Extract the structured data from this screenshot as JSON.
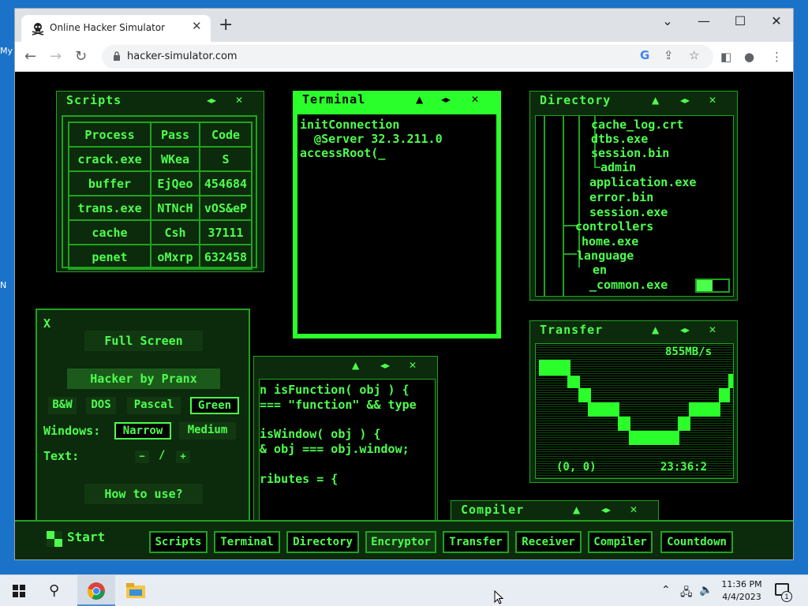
{
  "desktop": {
    "peek_label_1": "My",
    "peek_label_2": "N"
  },
  "browser": {
    "tab_title": "Online Hacker Simulator",
    "url": "hacker-simulator.com"
  },
  "panels": {
    "scripts": {
      "title": "Scripts",
      "headers": [
        "Process",
        "Pass",
        "Code"
      ],
      "rows": [
        [
          "crack.exe",
          "WKea",
          "S"
        ],
        [
          "buffer",
          "EjQeo",
          "454684"
        ],
        [
          "trans.exe",
          "NTNcH",
          "vOS&eP"
        ],
        [
          "cache",
          "Csh",
          "37111"
        ],
        [
          "penet",
          "oMxrp",
          "632458"
        ]
      ]
    },
    "terminal": {
      "title": "Terminal",
      "lines": [
        "initConnection",
        "  @Server 32.3.211.0",
        "accessRoot(_"
      ]
    },
    "directory": {
      "title": "Directory",
      "lines": [
        "cache_log.crt",
        "dtbs.exe",
        "session.bin",
        "admin",
        "application.exe",
        "error.bin",
        "session.exe",
        "controllers",
        "home.exe",
        "language",
        "en",
        "_common.exe"
      ]
    },
    "transfer": {
      "title": "Transfer",
      "speed": "855MB/s",
      "coords": "(0, 0)",
      "time": "23:36:2"
    },
    "encryptor": {
      "lines": [
        "n isFunction( obj ) {",
        "=== \"function\" && type",
        "",
        "isWindow( obj ) {",
        "& obj === obj.window;",
        "",
        "ributes = {"
      ]
    },
    "compiler": {
      "title": "Compiler"
    },
    "settings": {
      "close": "X",
      "full_screen": "Full Screen",
      "credit": "Hacker by Pranx",
      "colors": [
        "B&W",
        "DOS",
        "Pascal",
        "Green"
      ],
      "windows_label": "Windows:",
      "window_opts": [
        "Narrow",
        "Medium"
      ],
      "text_label": "Text:",
      "text_minus": "−",
      "text_slash": "/",
      "text_plus": "+",
      "how_to": "How to use?"
    }
  },
  "page_taskbar": {
    "start": "Start",
    "buttons": [
      "Scripts",
      "Terminal",
      "Directory",
      "Encryptor",
      "Transfer",
      "Receiver",
      "Compiler",
      "Countdown"
    ]
  },
  "system": {
    "time": "11:36 PM",
    "date": "4/4/2023",
    "notif_count": "1"
  },
  "colors": {
    "accent": "#4dff4d",
    "border": "#1fa31f",
    "panel_bg": "#0c2a0c"
  }
}
